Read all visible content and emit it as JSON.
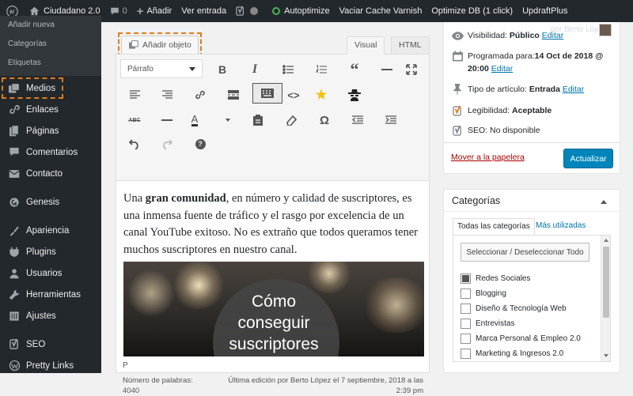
{
  "adminbar": {
    "site_name": "Ciudadano 2.0",
    "comments_count": "0",
    "new_label": "Añadir",
    "view_label": "Ver entrada",
    "autoptimize": "Autoptimize",
    "varnish": "Vaciar Cache Varnish",
    "optimize_db": "Optimize DB (1 click)",
    "updraft": "UpdraftPlus"
  },
  "sidebar": {
    "submenu": [
      "Añadir nueva",
      "Categorías",
      "Etiquetas"
    ],
    "items": [
      {
        "label": "Medios",
        "icon": "media-icon"
      },
      {
        "label": "Enlaces",
        "icon": "links-icon"
      },
      {
        "label": "Páginas",
        "icon": "pages-icon"
      },
      {
        "label": "Comentarios",
        "icon": "comments-icon"
      },
      {
        "label": "Contacto",
        "icon": "contact-icon"
      },
      {
        "label": "Genesis",
        "icon": "genesis-icon"
      },
      {
        "label": "Apariencia",
        "icon": "appearance-icon"
      },
      {
        "label": "Plugins",
        "icon": "plugins-icon"
      },
      {
        "label": "Usuarios",
        "icon": "users-icon"
      },
      {
        "label": "Herramientas",
        "icon": "tools-icon"
      },
      {
        "label": "Ajustes",
        "icon": "settings-icon"
      },
      {
        "label": "SEO",
        "icon": "seo-icon"
      },
      {
        "label": "Pretty Links",
        "icon": "pretty-links-icon"
      }
    ]
  },
  "editor": {
    "add_media": "Añadir objeto",
    "tab_visual": "Visual",
    "tab_html": "HTML",
    "format_select": "Párrafo",
    "paragraph_pre": "Una ",
    "paragraph_bold": "gran comunidad",
    "paragraph_post": ", en número y calidad de suscriptores, es una inmensa fuente de tráfico y el rasgo por excelencia de un canal YouTube exitoso. No es extraño que todos queramos tener muchos suscriptores en nuestro canal.",
    "image_line1": "Cómo",
    "image_line2": "conseguir",
    "image_line3": "suscriptores",
    "path": "P",
    "word_count_label": "Número de palabras:",
    "word_count": "4040",
    "last_edit": "Última edición por Berto López el 7 septiembre, 2018 a las",
    "last_edit_time": "2:39 pm"
  },
  "publish": {
    "ghost_user": "por Berto López",
    "visibility_label": "Visibilidad: ",
    "visibility_value": "Público",
    "edit": "Editar",
    "schedule_label": "Programada para:",
    "schedule_value": "14 Oct de 2018 @",
    "schedule_time": "20:00",
    "type_label": "Tipo de artículo: ",
    "type_value": "Entrada",
    "readability_label": "Legibilidad: ",
    "readability_value": "Aceptable",
    "seo_label": "SEO: ",
    "seo_value": "No disponible",
    "trash": "Mover a la papelera",
    "update": "Actualizar"
  },
  "categories": {
    "title": "Categorías",
    "tab_all": "Todas las categorías",
    "tab_used": "Más utilizadas",
    "select_all": "Seleccionar / Deseleccionar Todo",
    "items": [
      {
        "label": "Redes Sociales",
        "checked": true
      },
      {
        "label": "Blogging",
        "checked": false
      },
      {
        "label": "Diseño & Tecnología Web",
        "checked": false
      },
      {
        "label": "Entrevistas",
        "checked": false
      },
      {
        "label": "Marca Personal & Empleo 2.0",
        "checked": false
      },
      {
        "label": "Marketing & Ingresos 2.0",
        "checked": false
      }
    ]
  },
  "colors": {
    "adminbar": "#23282d",
    "accent_button": "#0085ba",
    "highlight_dashed": "#e07b1c",
    "link": "#0073aa",
    "trash": "#aa0000",
    "autoptimize_status": "#46b450"
  }
}
